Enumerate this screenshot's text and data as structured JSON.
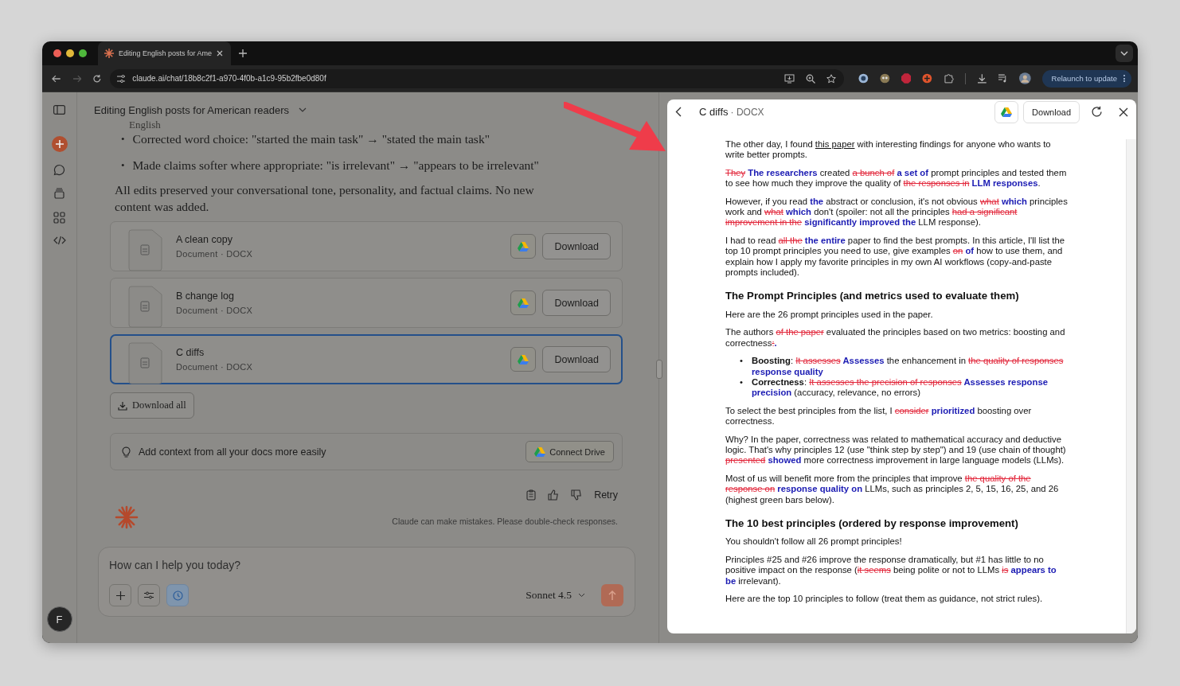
{
  "browser": {
    "tab_title": "Editing English posts for Ame",
    "url": "claude.ai/chat/18b8c2f1-a970-4f0b-a1c9-95b2fbe0d80f",
    "relaunch_button": "Relaunch to update"
  },
  "chat": {
    "title": "Editing English posts for American readers",
    "faded_text": "English",
    "bullets": [
      {
        "marker": "•",
        "text": "Corrected word choice: \"started the main task\" → \"stated the main task\""
      },
      {
        "marker": "•",
        "text": "Made claims softer where appropriate: \"is irrelevant\" → \"appears to be irrelevant\""
      }
    ],
    "summary": "All edits preserved your conversational tone, personality, and factual claims. No new content was added.",
    "files": [
      {
        "name": "A clean copy",
        "meta": "Document · DOCX",
        "button": "Download",
        "selected": false
      },
      {
        "name": "B change log",
        "meta": "Document · DOCX",
        "button": "Download",
        "selected": false
      },
      {
        "name": "C diffs",
        "meta": "Document · DOCX",
        "button": "Download",
        "selected": true
      }
    ],
    "download_all": "Download all",
    "context_banner": {
      "text": "Add context from all your docs more easily",
      "button": "Connect Drive"
    },
    "retry": "Retry",
    "disclaimer": "Claude can make mistakes. Please double-check responses.",
    "composer": {
      "placeholder": "How can I help you today?",
      "model": "Sonnet 4.5"
    },
    "avatar_letter": "F"
  },
  "document": {
    "title": "C diffs",
    "meta": "· DOCX",
    "download_button": "Download",
    "blocks": [
      {
        "kind": "para",
        "segments": [
          {
            "kind": "plain",
            "text": "The other day, I found "
          },
          {
            "kind": "link",
            "text": "this paper"
          },
          {
            "kind": "plain",
            "text": " with interesting findings for anyone who wants to write better prompts."
          }
        ]
      },
      {
        "kind": "para",
        "segments": [
          {
            "kind": "del",
            "text": "They"
          },
          {
            "kind": "ins",
            "text": " The researchers"
          },
          {
            "kind": "plain",
            "text": " created "
          },
          {
            "kind": "del",
            "text": "a bunch of"
          },
          {
            "kind": "ins",
            "text": " a set of"
          },
          {
            "kind": "plain",
            "text": " prompt principles and tested them to see how much they improve the quality of "
          },
          {
            "kind": "del",
            "text": "the responses in"
          },
          {
            "kind": "ins",
            "text": " LLM responses"
          },
          {
            "kind": "plain",
            "text": "."
          }
        ]
      },
      {
        "kind": "para",
        "segments": [
          {
            "kind": "plain",
            "text": "However, if you read "
          },
          {
            "kind": "ins",
            "text": "the"
          },
          {
            "kind": "plain",
            "text": " abstract or conclusion, it's not obvious "
          },
          {
            "kind": "del",
            "text": "what"
          },
          {
            "kind": "ins",
            "text": " which"
          },
          {
            "kind": "plain",
            "text": " principles work and "
          },
          {
            "kind": "del",
            "text": "what"
          },
          {
            "kind": "ins",
            "text": " which"
          },
          {
            "kind": "plain",
            "text": " don't (spoiler: not all the principles "
          },
          {
            "kind": "del",
            "text": "had a significant improvement in the"
          },
          {
            "kind": "ins",
            "text": " significantly improved the"
          },
          {
            "kind": "plain",
            "text": " LLM response)."
          }
        ]
      },
      {
        "kind": "para",
        "segments": [
          {
            "kind": "plain",
            "text": "I had to read "
          },
          {
            "kind": "del",
            "text": "all the"
          },
          {
            "kind": "ins",
            "text": " the entire"
          },
          {
            "kind": "plain",
            "text": " paper to find the best prompts. In this article, I'll list the top 10 prompt principles you need to use, give examples "
          },
          {
            "kind": "del",
            "text": "on"
          },
          {
            "kind": "ins",
            "text": " of"
          },
          {
            "kind": "plain",
            "text": " how to use them, and explain how I apply my favorite principles in my own AI workflows (copy-and-paste prompts included)."
          }
        ]
      },
      {
        "kind": "heading",
        "text": "The Prompt Principles (and metrics used to evaluate them)"
      },
      {
        "kind": "para",
        "segments": [
          {
            "kind": "plain",
            "text": "Here are the 26 prompt principles used in the paper."
          }
        ]
      },
      {
        "kind": "para",
        "segments": [
          {
            "kind": "plain",
            "text": "The authors "
          },
          {
            "kind": "del",
            "text": "of the paper"
          },
          {
            "kind": "plain",
            "text": " evaluated the principles based on two metrics: boosting and correctness"
          },
          {
            "kind": "del",
            "text": ":"
          },
          {
            "kind": "ins",
            "text": "."
          }
        ]
      },
      {
        "kind": "bullets",
        "items": [
          {
            "marker": "•",
            "segments": [
              {
                "kind": "bold",
                "text": "Boosting"
              },
              {
                "kind": "plain",
                "text": ": "
              },
              {
                "kind": "del",
                "text": "It assesses"
              },
              {
                "kind": "ins",
                "text": " Assesses"
              },
              {
                "kind": "plain",
                "text": " the enhancement in "
              },
              {
                "kind": "del",
                "text": "the quality of responses"
              },
              {
                "kind": "ins",
                "text": " response quality"
              }
            ]
          },
          {
            "marker": "•",
            "segments": [
              {
                "kind": "bold",
                "text": "Correctness"
              },
              {
                "kind": "plain",
                "text": ": "
              },
              {
                "kind": "del",
                "text": "It assesses the precision of responses"
              },
              {
                "kind": "ins",
                "text": " Assesses response precision"
              },
              {
                "kind": "plain",
                "text": " (accuracy, relevance, no errors)"
              }
            ]
          }
        ]
      },
      {
        "kind": "para",
        "segments": [
          {
            "kind": "plain",
            "text": "To select the best principles from the list, I "
          },
          {
            "kind": "del",
            "text": "consider"
          },
          {
            "kind": "ins",
            "text": " prioritized"
          },
          {
            "kind": "plain",
            "text": " boosting over correctness."
          }
        ]
      },
      {
        "kind": "para",
        "segments": [
          {
            "kind": "plain",
            "text": "Why? In the paper, correctness was related to mathematical accuracy and deductive logic. That's why principles 12 (use \"think step by step\") and 19 (use chain of thought) "
          },
          {
            "kind": "del",
            "text": "presented"
          },
          {
            "kind": "ins",
            "text": " showed"
          },
          {
            "kind": "plain",
            "text": " more correctness improvement in large language models (LLMs)."
          }
        ]
      },
      {
        "kind": "para",
        "segments": [
          {
            "kind": "plain",
            "text": "Most of us will benefit more from the principles that improve "
          },
          {
            "kind": "del",
            "text": "the quality of the response on"
          },
          {
            "kind": "ins",
            "text": " response quality on"
          },
          {
            "kind": "plain",
            "text": " LLMs, such as principles 2, 5, 15, 16, 25, and 26 (highest green bars below)."
          }
        ]
      },
      {
        "kind": "heading",
        "text": "The 10 best principles (ordered by response improvement)"
      },
      {
        "kind": "para",
        "segments": [
          {
            "kind": "plain",
            "text": "You shouldn't follow all 26 prompt principles!"
          }
        ]
      },
      {
        "kind": "para",
        "segments": [
          {
            "kind": "plain",
            "text": "Principles #25 and #26 improve the response dramatically, but #1 has little to no positive impact on the response ("
          },
          {
            "kind": "del",
            "text": "it seems"
          },
          {
            "kind": "plain",
            "text": " being polite or not to LLMs "
          },
          {
            "kind": "del",
            "text": "is"
          },
          {
            "kind": "ins",
            "text": " appears to be"
          },
          {
            "kind": "plain",
            "text": " irrelevant)."
          }
        ]
      },
      {
        "kind": "para",
        "segments": [
          {
            "kind": "plain",
            "text": "Here are the top 10 principles to follow (treat them as guidance, not strict rules)."
          }
        ]
      }
    ]
  }
}
